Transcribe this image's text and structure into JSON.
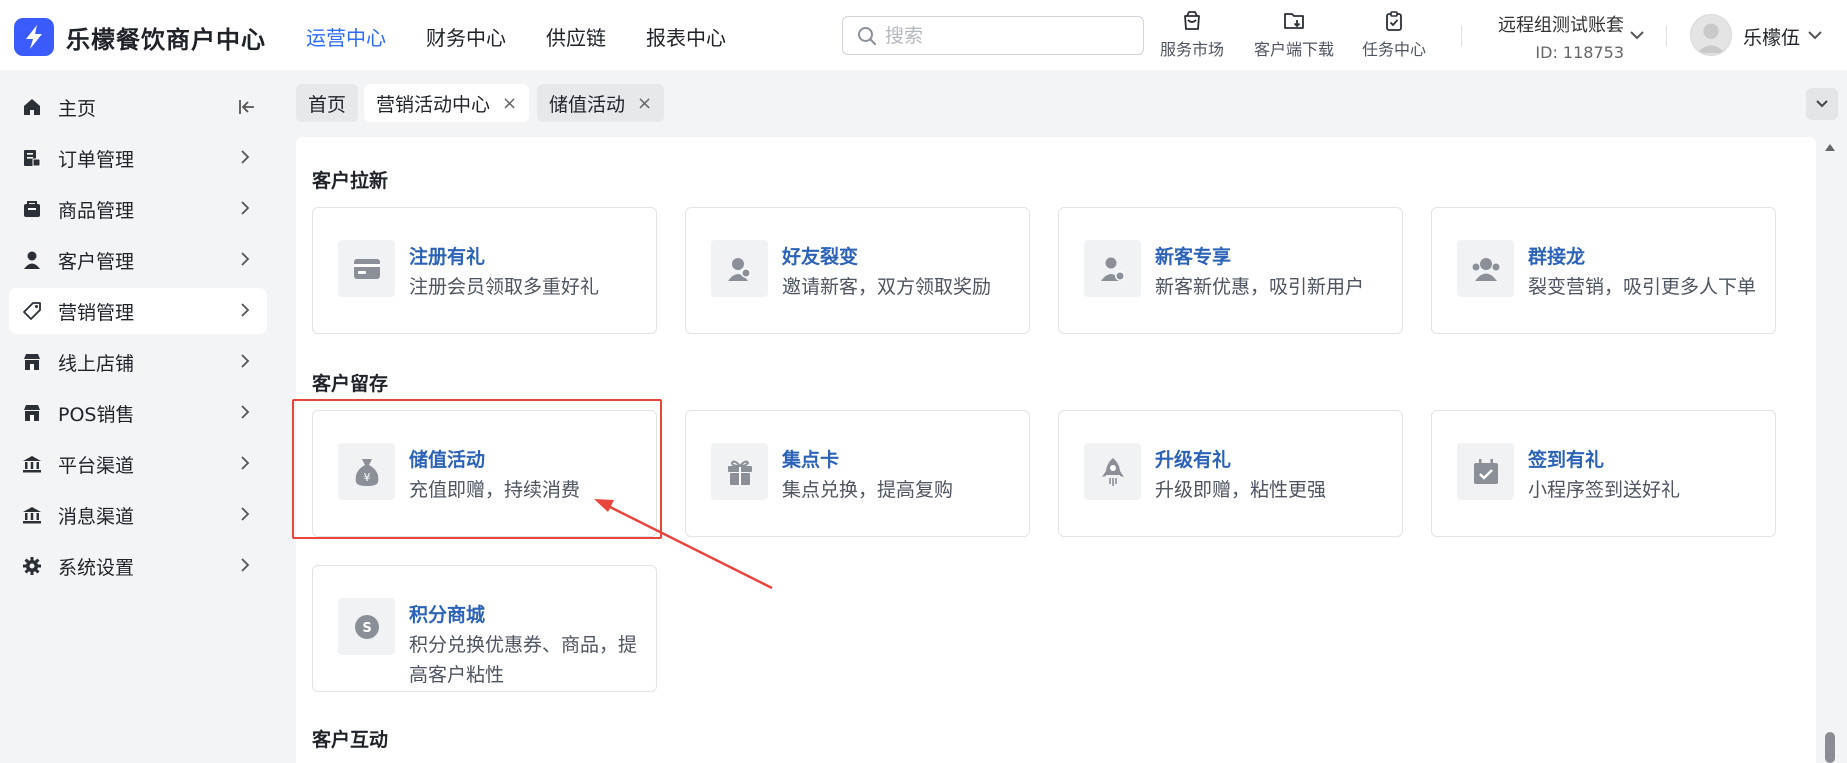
{
  "header": {
    "brand": "乐檬餐饮商户中心",
    "nav": [
      "运营中心",
      "财务中心",
      "供应链",
      "报表中心"
    ],
    "active_nav": "运营中心",
    "search_placeholder": "搜索",
    "tools": [
      "服务市场",
      "客户端下载",
      "任务中心"
    ],
    "account_name": "远程组测试账套",
    "account_id": "ID: 118753",
    "user_name": "乐檬伍"
  },
  "sidebar": {
    "items": [
      {
        "label": "主页",
        "icon": "home-icon"
      },
      {
        "label": "订单管理",
        "icon": "order-icon"
      },
      {
        "label": "商品管理",
        "icon": "goods-icon"
      },
      {
        "label": "客户管理",
        "icon": "user-icon"
      },
      {
        "label": "营销管理",
        "icon": "tag-icon"
      },
      {
        "label": "线上店铺",
        "icon": "store-icon"
      },
      {
        "label": "POS销售",
        "icon": "pos-icon"
      },
      {
        "label": "平台渠道",
        "icon": "bank-icon"
      },
      {
        "label": "消息渠道",
        "icon": "bank-icon"
      },
      {
        "label": "系统设置",
        "icon": "gear-icon"
      }
    ],
    "active": "营销管理"
  },
  "tabs": [
    {
      "label": "首页"
    },
    {
      "label": "营销活动中心",
      "close": "×"
    },
    {
      "label": "储值活动",
      "close": "×"
    }
  ],
  "content": {
    "sections": [
      {
        "title": "客户拉新",
        "cards": [
          {
            "title": "注册有礼",
            "desc": "注册会员领取多重好礼",
            "icon": "card-icon"
          },
          {
            "title": "好友裂变",
            "desc": "邀请新客，双方领取奖励",
            "icon": "friends-icon"
          },
          {
            "title": "新客专享",
            "desc": "新客新优惠，吸引新用户",
            "icon": "new-user-icon"
          },
          {
            "title": "群接龙",
            "desc": "裂变营销，吸引更多人下单",
            "icon": "group-icon"
          }
        ]
      },
      {
        "title": "客户留存",
        "cards": [
          {
            "title": "储值活动",
            "desc": "充值即赠，持续消费",
            "icon": "money-bag-icon"
          },
          {
            "title": "集点卡",
            "desc": "集点兑换，提高复购",
            "icon": "gift-icon"
          },
          {
            "title": "升级有礼",
            "desc": "升级即赠，粘性更强",
            "icon": "rocket-icon"
          },
          {
            "title": "签到有礼",
            "desc": "小程序签到送好礼",
            "icon": "calendar-check-icon"
          },
          {
            "title": "积分商城",
            "desc": "积分兑换优惠券、商品，提高客户粘性",
            "icon": "points-icon"
          }
        ]
      },
      {
        "title": "客户互动",
        "cards": []
      }
    ]
  },
  "colors": {
    "brand": "#3b5bfd",
    "active_nav": "#2f6bff",
    "card_title": "#2c63b8",
    "highlight": "#e8453c"
  }
}
